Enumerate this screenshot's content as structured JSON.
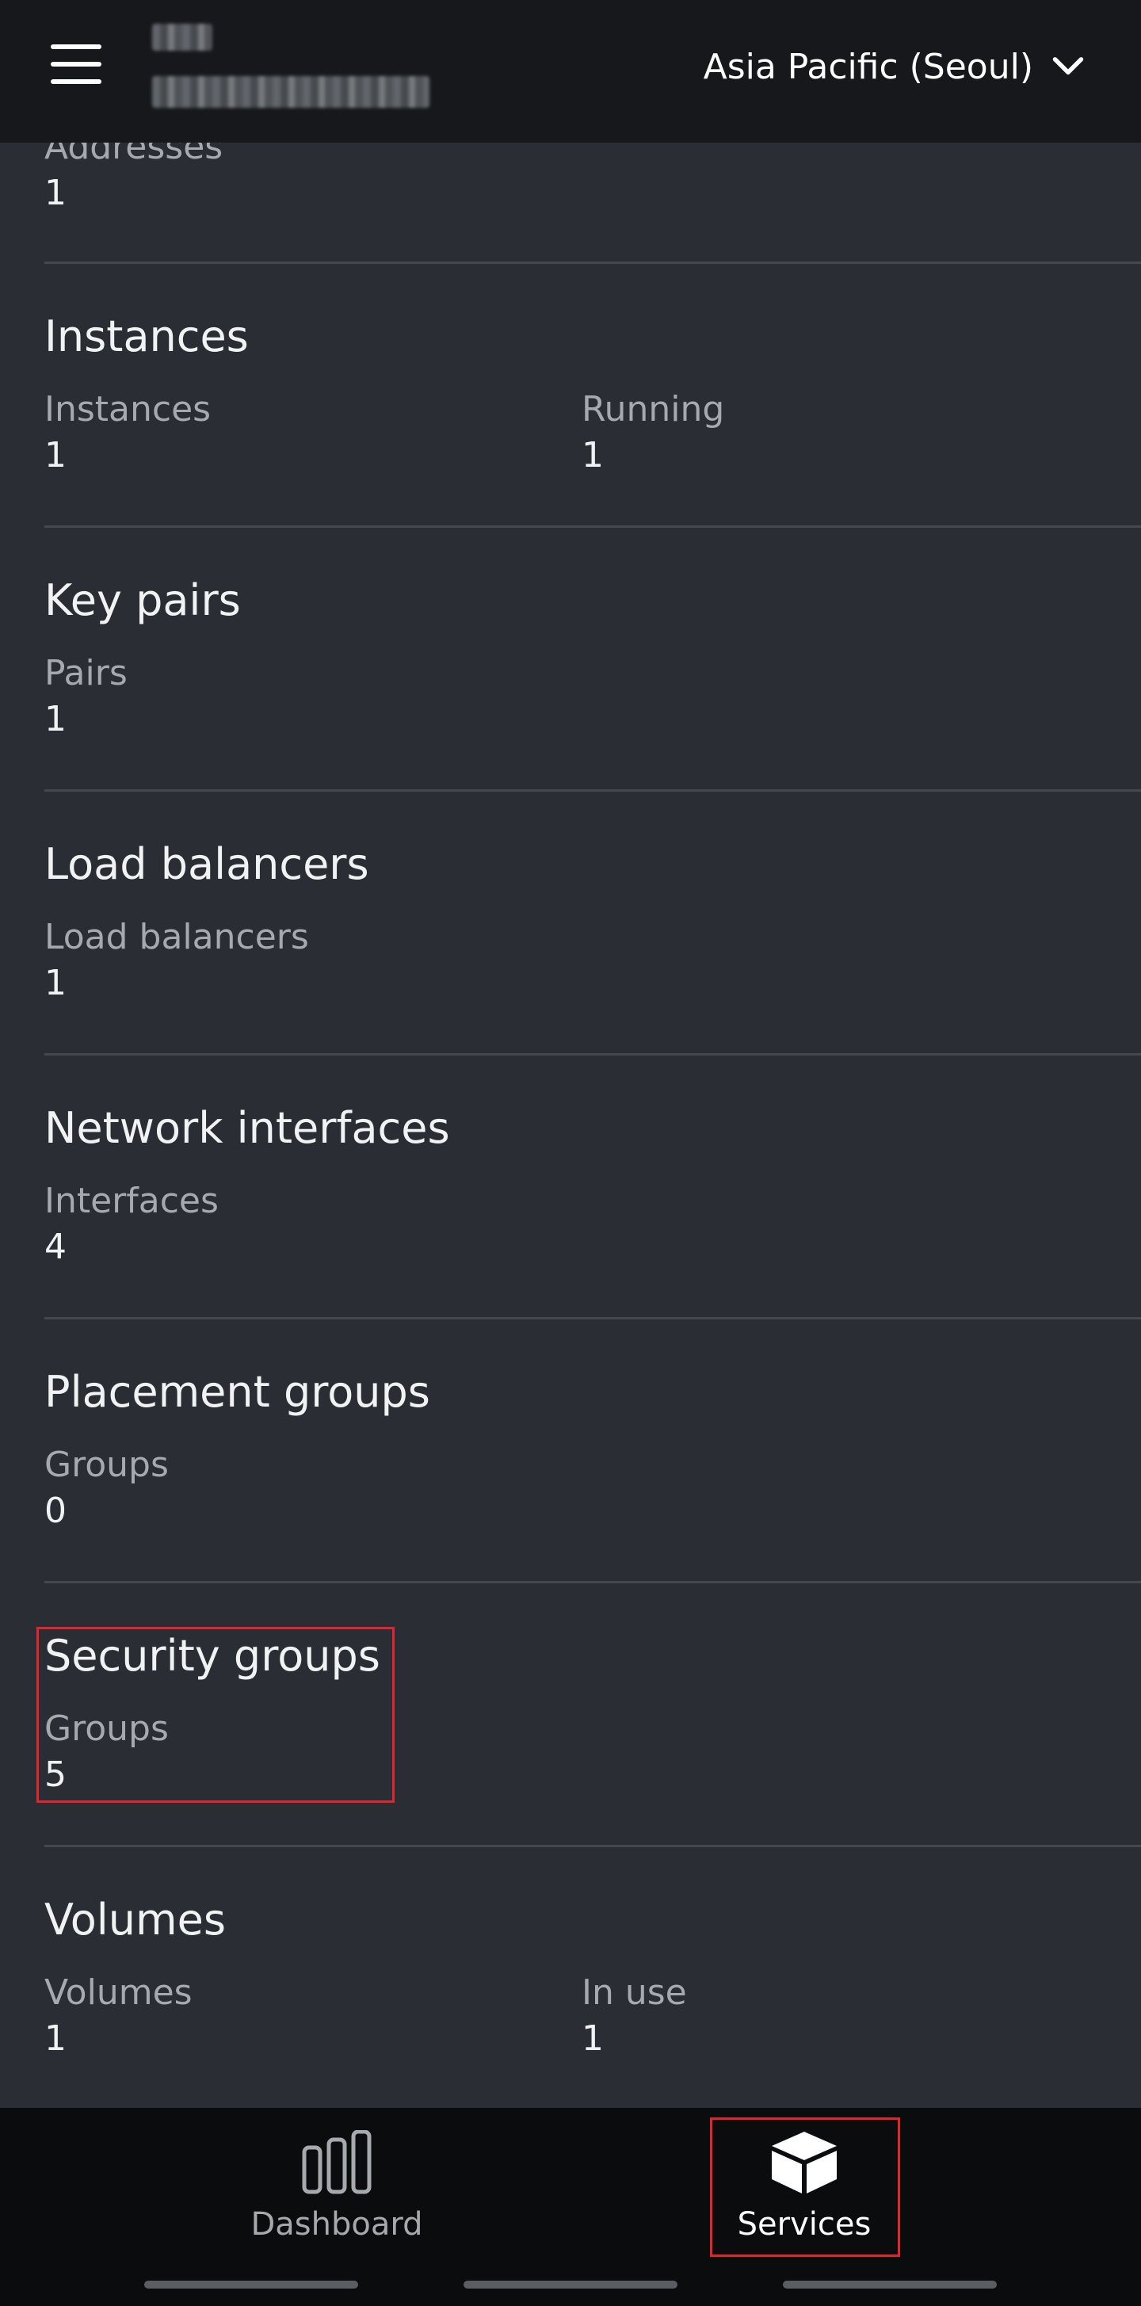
{
  "header": {
    "region_label": "Asia Pacific (Seoul)"
  },
  "sections": {
    "addresses": {
      "label": "Addresses",
      "value": "1"
    },
    "instances": {
      "title": "Instances",
      "metrics": [
        {
          "label": "Instances",
          "value": "1"
        },
        {
          "label": "Running",
          "value": "1"
        }
      ]
    },
    "key_pairs": {
      "title": "Key pairs",
      "metrics": [
        {
          "label": "Pairs",
          "value": "1"
        }
      ]
    },
    "load_balancers": {
      "title": "Load balancers",
      "metrics": [
        {
          "label": "Load balancers",
          "value": "1"
        }
      ]
    },
    "network_interfaces": {
      "title": "Network interfaces",
      "metrics": [
        {
          "label": "Interfaces",
          "value": "4"
        }
      ]
    },
    "placement_groups": {
      "title": "Placement groups",
      "metrics": [
        {
          "label": "Groups",
          "value": "0"
        }
      ]
    },
    "security_groups": {
      "title": "Security groups",
      "metrics": [
        {
          "label": "Groups",
          "value": "5"
        }
      ]
    },
    "volumes": {
      "title": "Volumes",
      "metrics": [
        {
          "label": "Volumes",
          "value": "1"
        },
        {
          "label": "In use",
          "value": "1"
        }
      ]
    }
  },
  "bottom_nav": {
    "dashboard_label": "Dashboard",
    "services_label": "Services"
  },
  "icons": {
    "menu": "hamburger-menu-icon",
    "region_dropdown": "chevron-down-icon",
    "dashboard": "bar-chart-icon",
    "services": "cube-icon"
  },
  "colors": {
    "background": "#2a2d33",
    "header": "#16181b",
    "bottom_nav": "#0b0c0d",
    "highlight": "#e0252f"
  }
}
